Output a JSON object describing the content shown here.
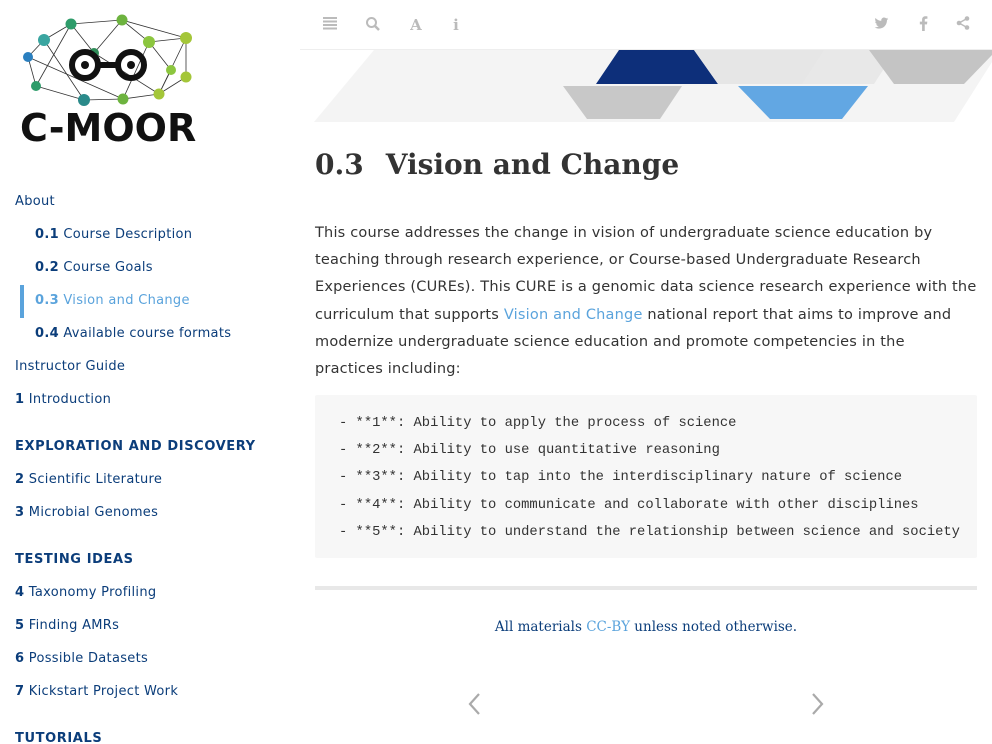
{
  "logo": {
    "text": "C-MOOR",
    "image_name": "c-moor-network-logo"
  },
  "toolbar": {
    "icons": [
      "menu-icon",
      "search-icon",
      "font-icon",
      "info-icon"
    ],
    "share_icons": [
      "twitter-icon",
      "facebook-icon",
      "share-icon"
    ]
  },
  "sidebar": {
    "items": [
      {
        "num": "",
        "label": "About"
      },
      {
        "num": "0.1",
        "label": "Course Description"
      },
      {
        "num": "0.2",
        "label": "Course Goals"
      },
      {
        "num": "0.3",
        "label": "Vision and Change"
      },
      {
        "num": "0.4",
        "label": "Available course formats"
      },
      {
        "num": "",
        "label": "Instructor Guide"
      },
      {
        "num": "1",
        "label": "Introduction"
      },
      {
        "num": "2",
        "label": "Scientific Literature"
      },
      {
        "num": "3",
        "label": "Microbial Genomes"
      },
      {
        "num": "4",
        "label": "Taxonomy Profiling"
      },
      {
        "num": "5",
        "label": "Finding AMRs"
      },
      {
        "num": "6",
        "label": "Possible Datasets"
      },
      {
        "num": "7",
        "label": "Kickstart Project Work"
      }
    ],
    "headers": [
      "Exploration and Discovery",
      "Testing Ideas",
      "Tutorials"
    ]
  },
  "main": {
    "section_number": "0.3",
    "title": "Vision and Change",
    "para_before": "This course addresses the change in vision of undergraduate science education by teaching through research experience, or Course-based Undergraduate Research Experiences (CUREs). This CURE is a genomic data science research experience with the curriculum that supports ",
    "para_link": "Vision and Change",
    "para_after": " national report that aims to improve and modernize undergraduate science education and promote competencies in the practices including:",
    "code_lines": [
      "- **1**: Ability to apply the process of science",
      "- **2**: Ability to use quantitative reasoning",
      "- **3**: Ability to tap into the interdisciplinary nature of science",
      "- **4**: Ability to communicate and collaborate with other disciplines",
      "- **5**: Ability to understand the relationship between science and society"
    ],
    "footer_before": "All materials ",
    "footer_link": "CC-BY",
    "footer_after": " unless noted otherwise."
  },
  "nav_arrows": {
    "prev": "‹",
    "next": "›"
  },
  "colors": {
    "navy": "#0b3d7a",
    "accent": "#5aa3dc",
    "code_bg": "#f7f7f7"
  }
}
